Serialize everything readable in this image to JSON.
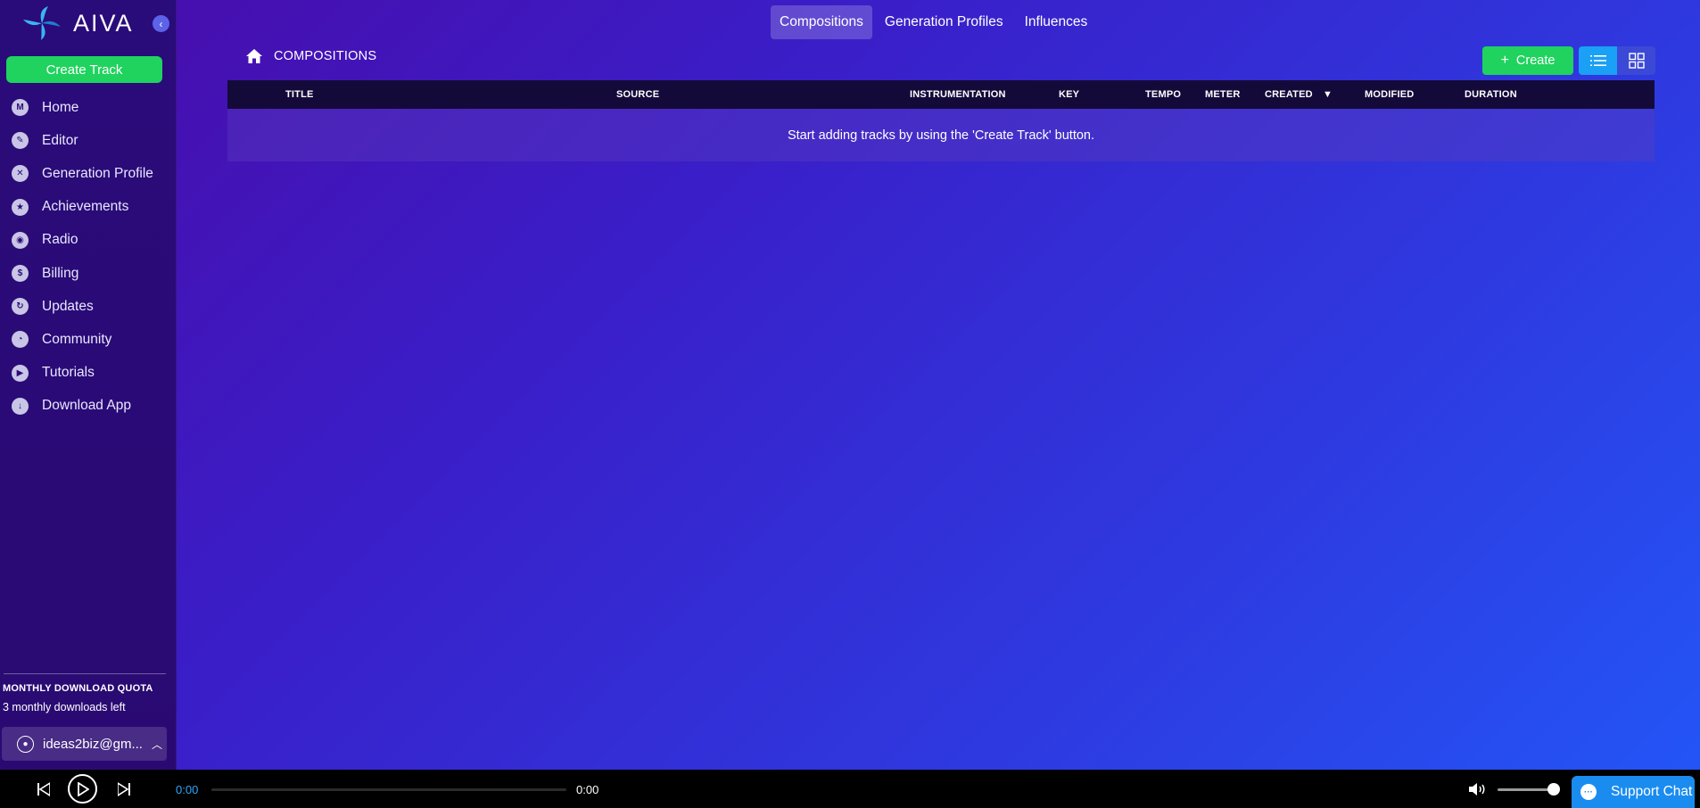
{
  "app": {
    "name": "AIVA"
  },
  "sidebar": {
    "create_label": "Create Track",
    "items": [
      {
        "label": "Home",
        "icon": "home-icon",
        "glyph": "M"
      },
      {
        "label": "Editor",
        "icon": "pencil-icon",
        "glyph": "✎"
      },
      {
        "label": "Generation Profile",
        "icon": "crossed-tools-icon",
        "glyph": "✕"
      },
      {
        "label": "Achievements",
        "icon": "medal-icon",
        "glyph": "★"
      },
      {
        "label": "Radio",
        "icon": "radio-icon",
        "glyph": "◉"
      },
      {
        "label": "Billing",
        "icon": "dollar-icon",
        "glyph": "$"
      },
      {
        "label": "Updates",
        "icon": "refresh-icon",
        "glyph": "↻"
      },
      {
        "label": "Community",
        "icon": "discord-icon",
        "glyph": "◔"
      },
      {
        "label": "Tutorials",
        "icon": "play-icon",
        "glyph": "▶"
      },
      {
        "label": "Download App",
        "icon": "download-icon",
        "glyph": "↓"
      }
    ],
    "quota": {
      "title": "MONTHLY DOWNLOAD QUOTA",
      "text": "3 monthly downloads left"
    },
    "user": {
      "email": "ideas2biz@gm..."
    }
  },
  "tabs": [
    {
      "label": "Compositions",
      "active": true
    },
    {
      "label": "Generation Profiles",
      "active": false
    },
    {
      "label": "Influences",
      "active": false
    }
  ],
  "breadcrumb": {
    "label": "COMPOSITIONS"
  },
  "toolbar": {
    "create_label": "Create"
  },
  "table": {
    "columns": [
      "TITLE",
      "SOURCE",
      "INSTRUMENTATION",
      "KEY",
      "TEMPO",
      "METER",
      "CREATED",
      "MODIFIED",
      "DURATION"
    ],
    "sorted_column": "CREATED",
    "empty_message": "Start adding tracks by using the 'Create Track' button."
  },
  "player": {
    "current_time": "0:00",
    "total_time": "0:00",
    "progress": 0,
    "volume": 0.9
  },
  "support": {
    "label": "Support Chat"
  },
  "colors": {
    "accent_green": "#1fd35e",
    "accent_blue": "#1aa0f5",
    "time_blue": "#2ea8ff"
  }
}
